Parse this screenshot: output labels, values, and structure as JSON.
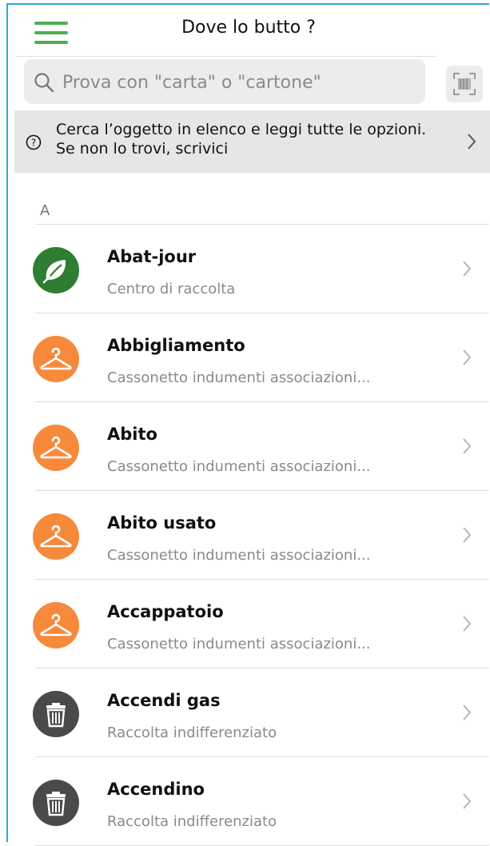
{
  "header": {
    "title": "Dove lo butto ?",
    "menu_icon": "hamburger-menu-icon",
    "accent_color": "#4caf50"
  },
  "search": {
    "placeholder": "Prova con \"carta\" o \"cartone\"",
    "value": "",
    "icon": "search-icon",
    "scan_icon": "barcode-scan-icon"
  },
  "info_banner": {
    "text": "Cerca l’oggetto in elenco e leggi tutte le opzioni. Se non lo trovi, scrivici",
    "icon": "question-circle-icon"
  },
  "section": {
    "letter": "A"
  },
  "items": [
    {
      "title": "Abat-jour",
      "subtitle": "Centro di raccolta",
      "icon": "leaf-icon",
      "color": "#2e7d32"
    },
    {
      "title": "Abbigliamento",
      "subtitle": "Cassonetto indumenti associazioni...",
      "icon": "hanger-icon",
      "color": "#f7893b"
    },
    {
      "title": "Abito",
      "subtitle": "Cassonetto indumenti associazioni...",
      "icon": "hanger-icon",
      "color": "#f7893b"
    },
    {
      "title": "Abito usato",
      "subtitle": "Cassonetto indumenti associazioni...",
      "icon": "hanger-icon",
      "color": "#f7893b"
    },
    {
      "title": "Accappatoio",
      "subtitle": "Cassonetto indumenti associazioni...",
      "icon": "hanger-icon",
      "color": "#f7893b"
    },
    {
      "title": "Accendi gas",
      "subtitle": "Raccolta indifferenziato",
      "icon": "trash-bin-icon",
      "color": "#4a4a4a"
    },
    {
      "title": "Accendino",
      "subtitle": "Raccolta indifferenziato",
      "icon": "trash-bin-icon",
      "color": "#4a4a4a"
    }
  ]
}
